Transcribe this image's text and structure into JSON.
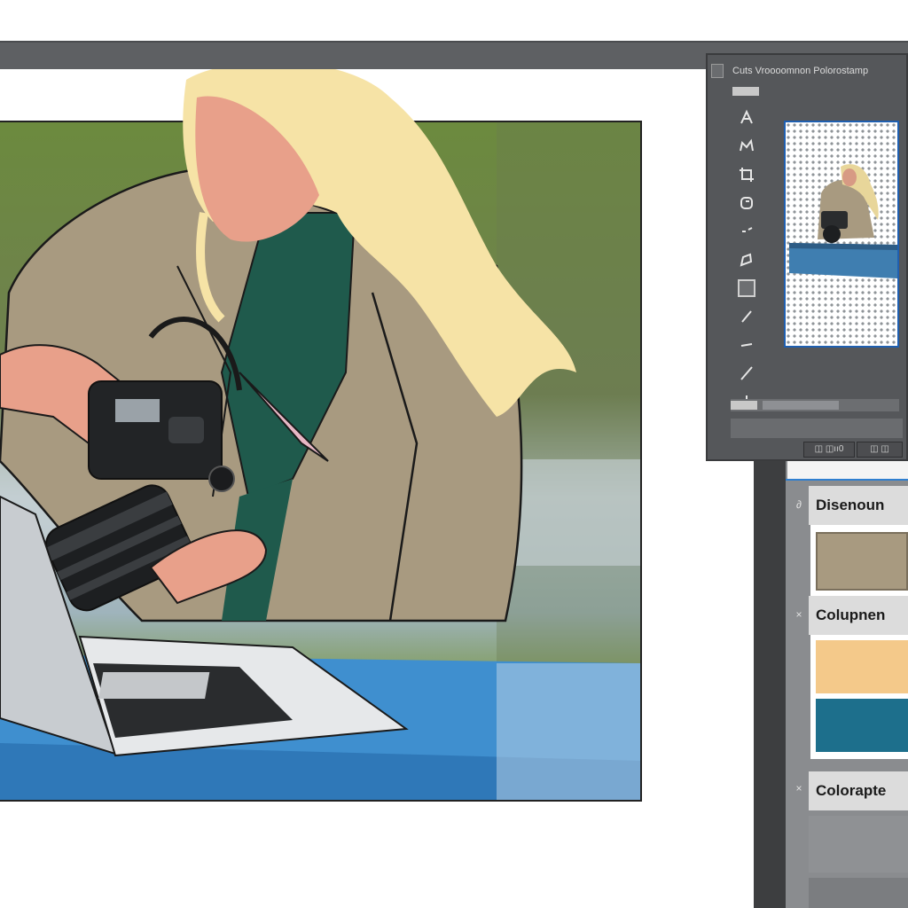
{
  "app": {
    "window_title": "Cuts Vroooomnon Polorostamp"
  },
  "tools": [
    {
      "name": "pen-tool-icon"
    },
    {
      "name": "crown-tool-icon"
    },
    {
      "name": "crop-tool-icon"
    },
    {
      "name": "lasso-tool-icon"
    },
    {
      "name": "brush-tool-icon"
    },
    {
      "name": "bucket-tool-icon"
    },
    {
      "name": "rectangle-tool-icon"
    },
    {
      "name": "pencil-tool-icon"
    },
    {
      "name": "line-tool-icon"
    },
    {
      "name": "eyedropper-tool-icon"
    },
    {
      "name": "move-tool-icon"
    }
  ],
  "status": {
    "left_label": "◫ ◫ıı0",
    "right_label": "◫ ◫"
  },
  "panel": {
    "sections": [
      {
        "title": "Disenoun",
        "swatches": [
          "#a89a80"
        ]
      },
      {
        "title": "Colupnen",
        "swatches": [
          "#f4c98a",
          "#1d6f8c"
        ]
      },
      {
        "title": "Colorapte",
        "swatches": []
      }
    ]
  },
  "colors": {
    "chrome_dark": "#55575a",
    "accent_blue": "#2f7fd0",
    "coat": "#a89a80",
    "hair": "#f6e3a6",
    "table_blue": "#3f8fcf"
  }
}
